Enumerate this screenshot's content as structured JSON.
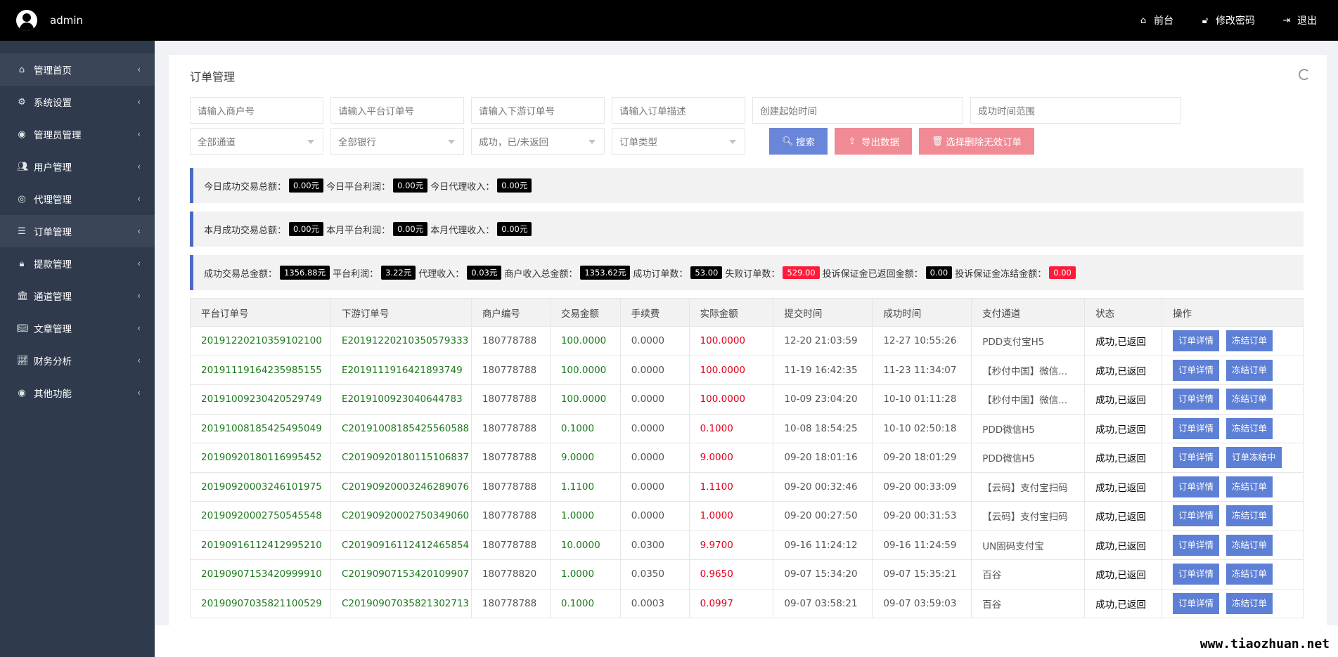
{
  "topbar": {
    "username": "admin",
    "links": [
      {
        "icon": "home-icon",
        "label": "前台"
      },
      {
        "icon": "lock-icon",
        "label": "修改密码"
      },
      {
        "icon": "logout-icon",
        "label": "退出"
      }
    ]
  },
  "sidebar": {
    "items": [
      {
        "icon": "home-icon",
        "label": "管理首页"
      },
      {
        "icon": "gear-icon",
        "label": "系统设置"
      },
      {
        "icon": "user-circle-icon",
        "label": "管理员管理"
      },
      {
        "icon": "users-icon",
        "label": "用户管理"
      },
      {
        "icon": "handshake-icon",
        "label": "代理管理"
      },
      {
        "icon": "list-icon",
        "label": "订单管理"
      },
      {
        "icon": "lock-icon",
        "label": "提款管理"
      },
      {
        "icon": "bank-icon",
        "label": "通道管理"
      },
      {
        "icon": "book-icon",
        "label": "文章管理"
      },
      {
        "icon": "chart-icon",
        "label": "财务分析"
      },
      {
        "icon": "user-circle-icon",
        "label": "其他功能"
      }
    ]
  },
  "page": {
    "title": "订单管理"
  },
  "filters": {
    "merchant_placeholder": "请输入商户号",
    "platform_order_placeholder": "请输入平台订单号",
    "downstream_order_placeholder": "请输入下游订单号",
    "order_desc_placeholder": "请输入订单描述",
    "create_time_placeholder": "创建起始时间",
    "success_time_placeholder": "成功时间范围",
    "channel_select": "全部通道",
    "bank_select": "全部银行",
    "status_select": "成功，已/未返回",
    "type_select": "订单类型",
    "search_label": "搜索",
    "export_label": "导出数据",
    "delete_label": "选择删除无效订单"
  },
  "colors": {
    "search_btn": "#6a86d8",
    "export_btn": "#f08a94",
    "delete_btn": "#f08a94"
  },
  "summary_today": {
    "l1": "今日成功交易总额：",
    "v1": "0.00元",
    "l2": "今日平台利润：",
    "v2": "0.00元",
    "l3": "今日代理收入：",
    "v3": "0.00元"
  },
  "summary_month": {
    "l1": "本月成功交易总额：",
    "v1": "0.00元",
    "l2": "本月平台利润：",
    "v2": "0.00元",
    "l3": "本月代理收入：",
    "v3": "0.00元"
  },
  "summary_total": {
    "l1": "成功交易总金额：",
    "v1": "1356.88元",
    "l2": "平台利润：",
    "v2": "3.22元",
    "l3": "代理收入：",
    "v3": "0.03元",
    "l4": "商户收入总金额：",
    "v4": "1353.62元",
    "l5": "成功订单数：",
    "v5": "53.00",
    "l6": "失败订单数：",
    "v6": "529.00",
    "l7": "投诉保证金已返回金额：",
    "v7": "0.00",
    "l8": "投诉保证金冻结金额：",
    "v8": "0.00"
  },
  "table": {
    "headers": [
      "平台订单号",
      "下游订单号",
      "商户编号",
      "交易金额",
      "手续费",
      "实际金额",
      "提交时间",
      "成功时间",
      "支付通道",
      "状态",
      "操作"
    ],
    "detail_label": "订单详情",
    "rows": [
      {
        "pid": "20191220210359102100",
        "did": "E20191220210350579333",
        "mid": "180778788",
        "amt": "100.0000",
        "fee": "0.0000",
        "real": "100.0000",
        "submit": "12-20 21:03:59",
        "success": "12-27 10:55:26",
        "channel": "PDD支付宝H5",
        "status": "成功,已返回",
        "action": "冻结订单"
      },
      {
        "pid": "20191119164235985155",
        "did": "E2019111916421893749",
        "mid": "180778788",
        "amt": "100.0000",
        "fee": "0.0000",
        "real": "100.0000",
        "submit": "11-19 16:42:35",
        "success": "11-23 11:34:07",
        "channel": "【秒付中国】微信...",
        "status": "成功,已返回",
        "action": "冻结订单"
      },
      {
        "pid": "20191009230420529749",
        "did": "E2019100923040644783",
        "mid": "180778788",
        "amt": "100.0000",
        "fee": "0.0000",
        "real": "100.0000",
        "submit": "10-09 23:04:20",
        "success": "10-10 01:11:28",
        "channel": "【秒付中国】微信...",
        "status": "成功,已返回",
        "action": "冻结订单"
      },
      {
        "pid": "20191008185425495049",
        "did": "C20191008185425560588",
        "mid": "180778788",
        "amt": "0.1000",
        "fee": "0.0000",
        "real": "0.1000",
        "submit": "10-08 18:54:25",
        "success": "10-10 02:50:18",
        "channel": "PDD微信H5",
        "status": "成功,已返回",
        "action": "冻结订单"
      },
      {
        "pid": "20190920180116995452",
        "did": "C20190920180115106837",
        "mid": "180778788",
        "amt": "9.0000",
        "fee": "0.0000",
        "real": "9.0000",
        "submit": "09-20 18:01:16",
        "success": "09-20 18:01:29",
        "channel": "PDD微信H5",
        "status": "成功,已返回",
        "action": "订单冻结中"
      },
      {
        "pid": "20190920003246101975",
        "did": "C20190920003246289076",
        "mid": "180778788",
        "amt": "1.1100",
        "fee": "0.0000",
        "real": "1.1100",
        "submit": "09-20 00:32:46",
        "success": "09-20 00:33:09",
        "channel": "【云码】支付宝扫码",
        "status": "成功,已返回",
        "action": "冻结订单"
      },
      {
        "pid": "20190920002750545548",
        "did": "C20190920002750349060",
        "mid": "180778788",
        "amt": "1.0000",
        "fee": "0.0000",
        "real": "1.0000",
        "submit": "09-20 00:27:50",
        "success": "09-20 00:31:53",
        "channel": "【云码】支付宝扫码",
        "status": "成功,已返回",
        "action": "冻结订单"
      },
      {
        "pid": "20190916112412995210",
        "did": "C20190916112412465854",
        "mid": "180778788",
        "amt": "10.0000",
        "fee": "0.0300",
        "real": "9.9700",
        "submit": "09-16 11:24:12",
        "success": "09-16 11:24:59",
        "channel": "UN固码支付宝",
        "status": "成功,已返回",
        "action": "冻结订单"
      },
      {
        "pid": "20190907153420999910",
        "did": "C20190907153420109907",
        "mid": "180778820",
        "amt": "1.0000",
        "fee": "0.0350",
        "real": "0.9650",
        "submit": "09-07 15:34:20",
        "success": "09-07 15:35:21",
        "channel": "百谷",
        "status": "成功,已返回",
        "action": "冻结订单"
      },
      {
        "pid": "20190907035821100529",
        "did": "C20190907035821302713",
        "mid": "180778788",
        "amt": "0.1000",
        "fee": "0.0003",
        "real": "0.0997",
        "submit": "09-07 03:58:21",
        "success": "09-07 03:59:03",
        "channel": "百谷",
        "status": "成功,已返回",
        "action": "冻结订单"
      }
    ]
  },
  "watermark": "www.tiaozhuan.net"
}
